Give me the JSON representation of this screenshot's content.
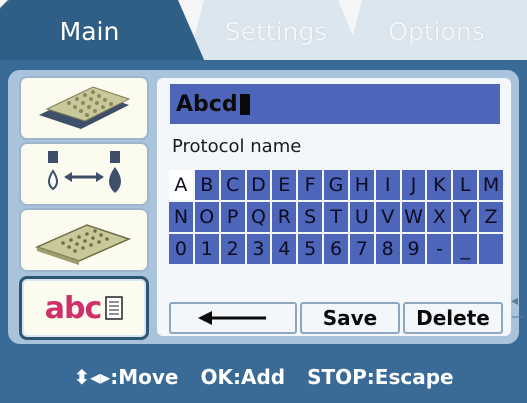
{
  "tabs": [
    {
      "label": "Main",
      "active": true
    },
    {
      "label": "Settings",
      "active": false
    },
    {
      "label": "Options",
      "active": false
    }
  ],
  "sidebar": [
    {
      "icon": "plate-icon",
      "selected": false
    },
    {
      "icon": "dispense-transfer-icon",
      "selected": false
    },
    {
      "icon": "microplate-icon",
      "selected": false
    },
    {
      "icon": "text-edit-icon",
      "label": "abc",
      "selected": true
    }
  ],
  "editor": {
    "value": "Abcd",
    "field_label": "Protocol name"
  },
  "keyboard": {
    "rows": [
      [
        "A",
        "B",
        "C",
        "D",
        "E",
        "F",
        "G",
        "H",
        "I",
        "J",
        "K",
        "L",
        "M"
      ],
      [
        "N",
        "O",
        "P",
        "Q",
        "R",
        "S",
        "T",
        "U",
        "V",
        "W",
        "X",
        "Y",
        "Z"
      ],
      [
        "0",
        "1",
        "2",
        "3",
        "4",
        "5",
        "6",
        "7",
        "8",
        "9",
        "-",
        "_",
        ""
      ]
    ],
    "selected": "A"
  },
  "actions": {
    "back_icon": "left-arrow-icon",
    "save": "Save",
    "delete": "Delete"
  },
  "footer": {
    "move": ":Move",
    "add": "OK:Add",
    "escape": "STOP:Escape"
  },
  "colors": {
    "panel": "#3a6b97",
    "inner": "#a9c3dc",
    "key": "#4d66b9",
    "sidebar_text_abc": "#d0306a",
    "sidebar_text_c": "#1f8a3a"
  }
}
